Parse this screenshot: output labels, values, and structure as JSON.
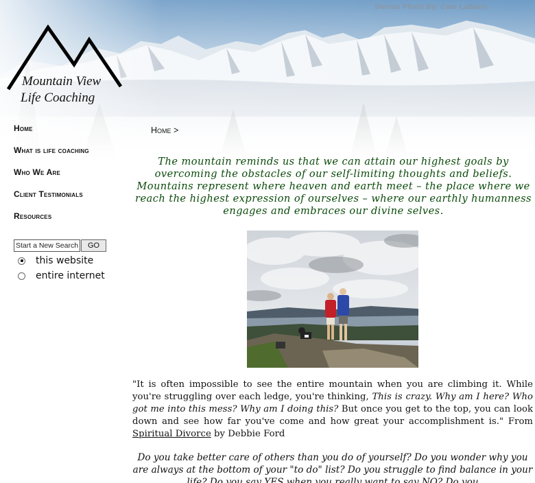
{
  "banner": {
    "photo_credit": "Sierras Photo By: Cate LaBarre"
  },
  "logo": {
    "line1": "Mountain View",
    "line2": "Life Coaching"
  },
  "nav": {
    "items": [
      {
        "label": "Home"
      },
      {
        "label": "What is life coaching"
      },
      {
        "label": "Who We Are"
      },
      {
        "label": "Client Testimonials"
      },
      {
        "label": "Resources"
      }
    ]
  },
  "search": {
    "value": "Start a New Search",
    "go_label": "GO",
    "options": [
      {
        "label": "this website",
        "selected": true
      },
      {
        "label": "entire internet",
        "selected": false
      }
    ]
  },
  "breadcrumb": "Home >",
  "quote": "The mountain reminds us that we can attain our highest goals by overcoming the obstacles of our self-limiting thoughts and beliefs. Mountains represent where heaven and earth meet – the place where we reach the highest expression of ourselves – where our earthly humanness engages and embraces our divine selves.",
  "colors": {
    "quote": "#0a4a0a",
    "sky": "#7fa6c9"
  },
  "body": {
    "part1": "\"It is often impossible to see the entire mountain when you are climbing it. While you're struggling over each ledge, you're thinking, ",
    "italic": "This is crazy. Why am I here? Who got me into this mess? Why am I doing this?",
    "part2": " But once you get to the top, you can look down and see how far you've come and how great your accomplishment is.\" From ",
    "book": "Spiritual Divorce",
    "part3": " by Debbie Ford"
  },
  "bottom_text": "Do you take better care of others than you do of yourself? Do you wonder why you are always at the bottom of your \"to do\" list? Do you struggle to find balance in your life? Do you say YES when you really want to say NO? Do you"
}
